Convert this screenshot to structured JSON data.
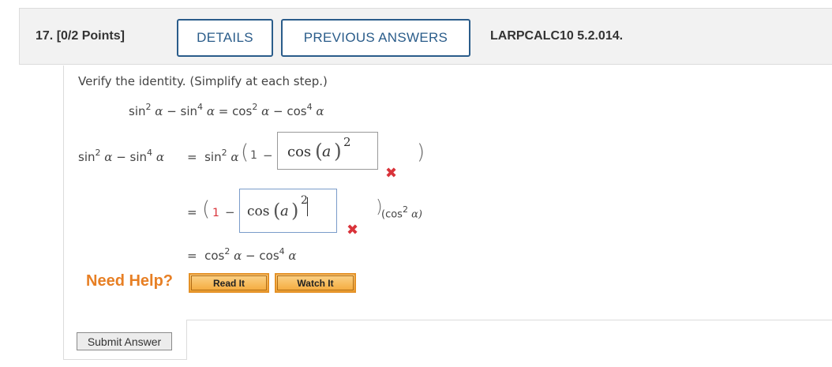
{
  "question": {
    "number_label": "17.",
    "points_label": "[0/2 Points]",
    "details_label": "DETAILS",
    "previous_answers_label": "PREVIOUS ANSWERS",
    "course_code": "LARPCALC10 5.2.014."
  },
  "prompt": "Verify the identity. (Simplify at each step.)",
  "identity": {
    "lhs_sin2": "sin",
    "alpha": "α",
    "minus": "−",
    "equals": "="
  },
  "steps": {
    "step1_factor_prefix": "sin",
    "step1_inner_one": "1",
    "answer1_text": "cos",
    "answer1_arg": "a",
    "answer1_exp": "2",
    "step2_inner_one": "1",
    "answer2_text": "cos",
    "answer2_arg": "a",
    "answer2_exp": "2",
    "step2_suffix": "(cos",
    "step2_suffix_end": "α)"
  },
  "status": {
    "answer1_mark": "✖",
    "answer2_mark": "✖",
    "incorrect_color": "#d9333a"
  },
  "help": {
    "label": "Need Help?",
    "read_it": "Read It",
    "watch_it": "Watch It"
  },
  "submit_label": "Submit Answer",
  "colors": {
    "accent": "#2a5c8a",
    "help_orange": "#e77f24",
    "red_one": "#d9333a"
  }
}
